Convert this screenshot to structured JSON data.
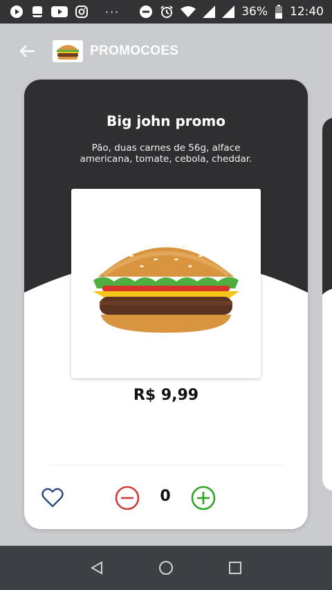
{
  "status_bar": {
    "battery_percent": "36%",
    "time": "12:40",
    "more_dots": "···",
    "icons": [
      "video-icon",
      "storage-icon",
      "youtube-icon",
      "instagram-icon",
      "do-not-disturb-icon",
      "alarm-icon",
      "wifi-icon",
      "signal-icon",
      "signal-icon",
      "battery-icon"
    ]
  },
  "header": {
    "title": "PROMOCOES",
    "back_icon": "back-arrow-icon",
    "logo_icon": "burger-logo-icon"
  },
  "product": {
    "name": "Big john promo",
    "description": "Pão, duas carnes de 56g, alface americana, tomate, cebola, cheddar.",
    "price": "R$ 9,99",
    "image_icon": "burger-image",
    "quantity": "0"
  },
  "actions": {
    "favorite_icon": "heart-icon",
    "decrease_icon": "minus-circle-icon",
    "increase_icon": "plus-circle-icon"
  },
  "nav": {
    "back_icon": "nav-back-icon",
    "home_icon": "nav-home-icon",
    "recents_icon": "nav-recents-icon"
  },
  "colors": {
    "card_dark": "#2f2e30",
    "minus_red": "#d03a3a",
    "plus_green": "#2aa61f",
    "heart_blue": "#2b4a7c",
    "background": "#c9cbce"
  }
}
